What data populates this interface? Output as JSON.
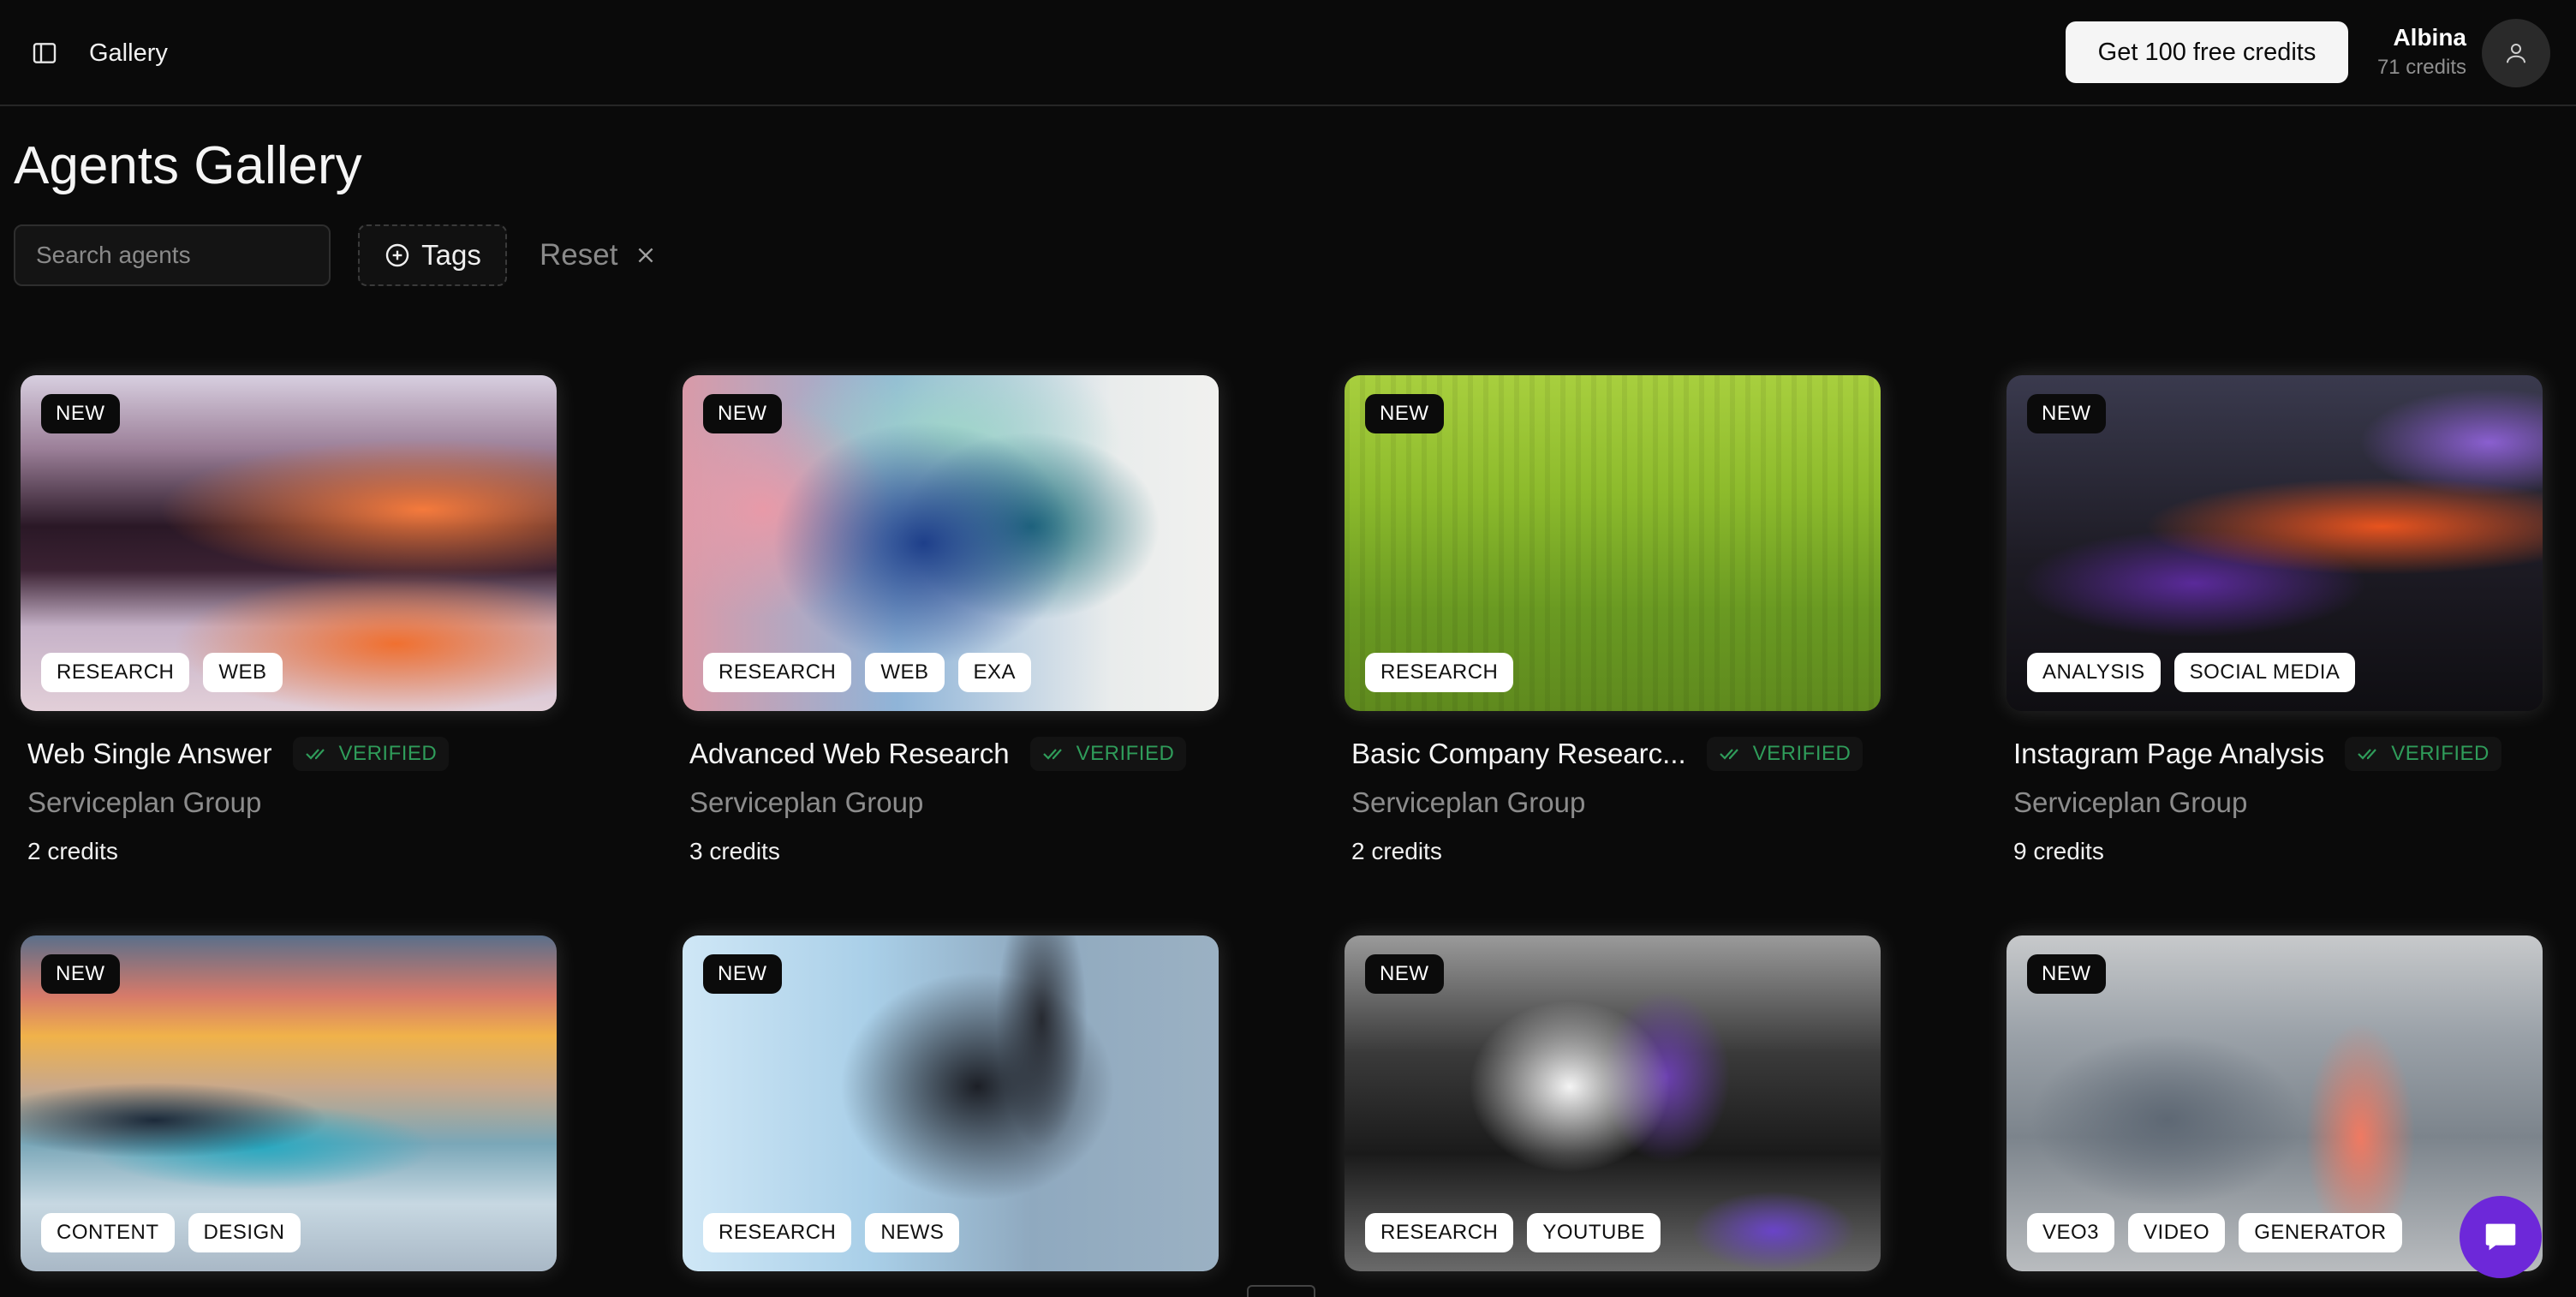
{
  "header": {
    "breadcrumb": "Gallery",
    "cta_label": "Get 100 free credits",
    "user_name": "Albina",
    "user_credits": "71 credits",
    "icons": {
      "sidebar": "sidebar-toggle-icon",
      "avatar": "user-icon"
    }
  },
  "page": {
    "title": "Agents Gallery",
    "search_placeholder": "Search agents",
    "tags_label": "Tags",
    "reset_label": "Reset"
  },
  "colors": {
    "background": "#0a0a0a",
    "verified": "#2f9c5a",
    "chat_accent": "#6d28d9"
  },
  "cards": [
    {
      "badge": "NEW",
      "tags": [
        "RESEARCH",
        "WEB"
      ],
      "title": "Web Single Answer",
      "verified": "VERIFIED",
      "owner": "Serviceplan Group",
      "credits": "2 credits",
      "art": "sunset-purple-orange"
    },
    {
      "badge": "NEW",
      "tags": [
        "RESEARCH",
        "WEB",
        "EXA"
      ],
      "title": "Advanced Web Research",
      "verified": "VERIFIED",
      "owner": "Serviceplan Group",
      "credits": "3 credits",
      "art": "blue-teal-cloud"
    },
    {
      "badge": "NEW",
      "tags": [
        "RESEARCH"
      ],
      "title": "Basic Company Researc...",
      "verified": "VERIFIED",
      "owner": "Serviceplan Group",
      "credits": "2 credits",
      "art": "green-gradient"
    },
    {
      "badge": "NEW",
      "tags": [
        "ANALYSIS",
        "SOCIAL MEDIA"
      ],
      "title": "Instagram Page Analysis",
      "verified": "VERIFIED",
      "owner": "Serviceplan Group",
      "credits": "9 credits",
      "art": "dark-purple-orange"
    },
    {
      "badge": "NEW",
      "tags": [
        "CONTENT",
        "DESIGN"
      ],
      "art": "pastel-sky-teal"
    },
    {
      "badge": "NEW",
      "tags": [
        "RESEARCH",
        "NEWS"
      ],
      "art": "lightblue-dark-blocks"
    },
    {
      "badge": "NEW",
      "tags": [
        "RESEARCH",
        "YOUTUBE"
      ],
      "art": "grey-light-purple"
    },
    {
      "badge": "NEW",
      "tags": [
        "VEO3",
        "VIDEO",
        "GENERATOR"
      ],
      "art": "grey-coral-shore"
    }
  ],
  "chat": {
    "icon": "chat-icon"
  }
}
